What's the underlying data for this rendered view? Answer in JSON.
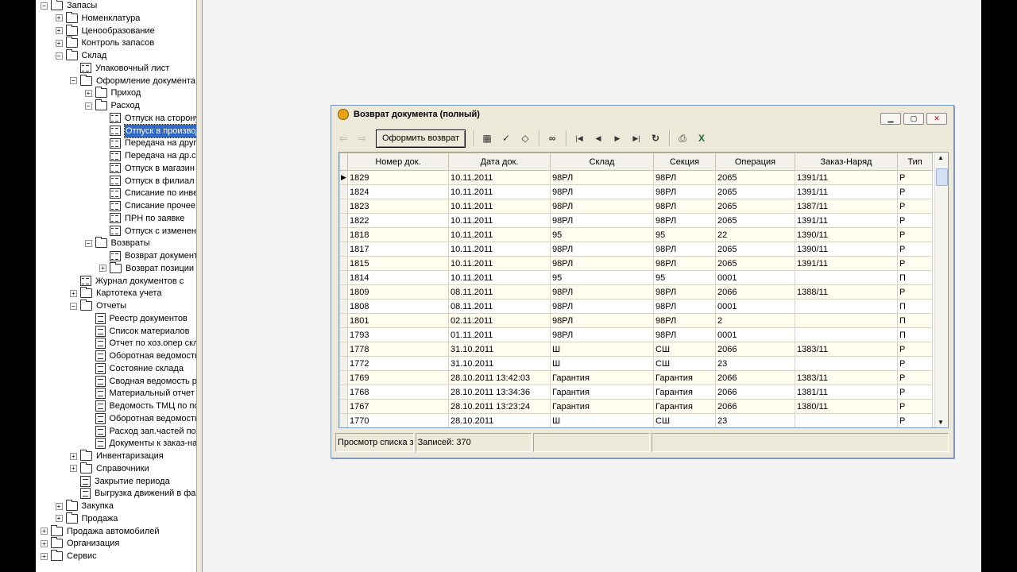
{
  "tree": {
    "items": [
      {
        "label": "Запасы",
        "icon": "folder",
        "toggle": "-"
      },
      {
        "label": "Номенклатура",
        "icon": "folder",
        "toggle": "+"
      },
      {
        "label": "Ценообразование",
        "icon": "folder",
        "toggle": "+"
      },
      {
        "label": "Контроль запасов",
        "icon": "folder",
        "toggle": "+"
      },
      {
        "label": "Склад",
        "icon": "folder",
        "toggle": "-"
      },
      {
        "label": "Упаковочный лист",
        "icon": "list",
        "toggle": ""
      },
      {
        "label": "Оформление документа",
        "icon": "folder",
        "toggle": "-"
      },
      {
        "label": "Приход",
        "icon": "folder",
        "toggle": "+"
      },
      {
        "label": "Расход",
        "icon": "folder",
        "toggle": "-"
      },
      {
        "label": "Отпуск на сторону",
        "icon": "list",
        "toggle": ""
      },
      {
        "label": "Отпуск в производ",
        "icon": "list",
        "toggle": ""
      },
      {
        "label": "Передача на другой",
        "icon": "list",
        "toggle": ""
      },
      {
        "label": "Передача на др.скл",
        "icon": "list",
        "toggle": ""
      },
      {
        "label": "Отпуск в магазин",
        "icon": "list",
        "toggle": ""
      },
      {
        "label": "Отпуск в филиал",
        "icon": "list",
        "toggle": ""
      },
      {
        "label": "Списание по инвент",
        "icon": "list",
        "toggle": ""
      },
      {
        "label": "Списание прочее",
        "icon": "list",
        "toggle": ""
      },
      {
        "label": "ПРН по заявке",
        "icon": "list",
        "toggle": ""
      },
      {
        "label": "Отпуск с изменен",
        "icon": "list",
        "toggle": ""
      },
      {
        "label": "Возвраты",
        "icon": "folder",
        "toggle": "-"
      },
      {
        "label": "Возврат документ",
        "icon": "list",
        "toggle": ""
      },
      {
        "label": "Возврат позиции д",
        "icon": "folder",
        "toggle": "+"
      },
      {
        "label": "Журнал документов с",
        "icon": "list",
        "toggle": ""
      },
      {
        "label": "Картотека учета",
        "icon": "folder",
        "toggle": "+"
      },
      {
        "label": "Отчеты",
        "icon": "folder",
        "toggle": "-"
      },
      {
        "label": "Реестр документов",
        "icon": "doc",
        "toggle": ""
      },
      {
        "label": "Список материалов",
        "icon": "doc",
        "toggle": ""
      },
      {
        "label": "Отчет по хоз.опер скл",
        "icon": "doc",
        "toggle": ""
      },
      {
        "label": "Оборотная ведомость",
        "icon": "doc",
        "toggle": ""
      },
      {
        "label": "Состояние склада",
        "icon": "doc",
        "toggle": ""
      },
      {
        "label": "Сводная ведомость ра",
        "icon": "doc",
        "toggle": ""
      },
      {
        "label": "Материальный отчет",
        "icon": "doc",
        "toggle": ""
      },
      {
        "label": "Ведомость ТМЦ по по",
        "icon": "doc",
        "toggle": ""
      },
      {
        "label": "Оборотная ведомость",
        "icon": "doc",
        "toggle": ""
      },
      {
        "label": "Расход зап.частей по",
        "icon": "doc",
        "toggle": ""
      },
      {
        "label": "Документы к заказ-на",
        "icon": "doc",
        "toggle": ""
      },
      {
        "label": "Инвентаризация",
        "icon": "folder",
        "toggle": "+"
      },
      {
        "label": "Справочники",
        "icon": "folder",
        "toggle": "+"
      },
      {
        "label": "Закрытие периода",
        "icon": "doc",
        "toggle": ""
      },
      {
        "label": "Выгрузка движений в фай",
        "icon": "doc",
        "toggle": ""
      },
      {
        "label": "Закупка",
        "icon": "folder",
        "toggle": "+"
      },
      {
        "label": "Продажа",
        "icon": "folder",
        "toggle": "+"
      },
      {
        "label": "Продажа автомобилей",
        "icon": "folder",
        "toggle": "+"
      },
      {
        "label": "Организация",
        "icon": "folder",
        "toggle": "+"
      },
      {
        "label": "Сервис",
        "icon": "folder",
        "toggle": "+"
      }
    ]
  },
  "dialog": {
    "title": "Возврат документа (полный)",
    "toolbar": {
      "process_return_label": "Оформить возврат"
    },
    "columns": [
      "Номер док.",
      "Дата док.",
      "Склад",
      "Секция",
      "Операция",
      "Заказ-Наряд",
      "Тип"
    ],
    "rows": [
      [
        "1829",
        "10.11.2011",
        "98РЛ",
        "98РЛ",
        "2065",
        "1391/11",
        "Р"
      ],
      [
        "1824",
        "10.11.2011",
        "98РЛ",
        "98РЛ",
        "2065",
        "1391/11",
        "Р"
      ],
      [
        "1823",
        "10.11.2011",
        "98РЛ",
        "98РЛ",
        "2065",
        "1387/11",
        "Р"
      ],
      [
        "1822",
        "10.11.2011",
        "98РЛ",
        "98РЛ",
        "2065",
        "1391/11",
        "Р"
      ],
      [
        "1818",
        "10.11.2011",
        "95",
        "95",
        "22",
        "1390/11",
        "Р"
      ],
      [
        "1817",
        "10.11.2011",
        "98РЛ",
        "98РЛ",
        "2065",
        "1390/11",
        "Р"
      ],
      [
        "1815",
        "10.11.2011",
        "98РЛ",
        "98РЛ",
        "2065",
        "1391/11",
        "Р"
      ],
      [
        "1814",
        "10.11.2011",
        "95",
        "95",
        "0001",
        "",
        "П"
      ],
      [
        "1809",
        "08.11.2011",
        "98РЛ",
        "98РЛ",
        "2066",
        "1388/11",
        "Р"
      ],
      [
        "1808",
        "08.11.2011",
        "98РЛ",
        "98РЛ",
        "0001",
        "",
        "П"
      ],
      [
        "1801",
        "02.11.2011",
        "98РЛ",
        "98РЛ",
        "2",
        "",
        "П"
      ],
      [
        "1793",
        "01.11.2011",
        "98РЛ",
        "98РЛ",
        "0001",
        "",
        "П"
      ],
      [
        "1778",
        "31.10.2011",
        "Ш",
        "СШ",
        "2066",
        "1383/11",
        "Р"
      ],
      [
        "1772",
        "31.10.2011",
        "Ш",
        "СШ",
        "23",
        "",
        "Р"
      ],
      [
        "1769",
        "28.10.2011 13:42:03",
        "Гарантия",
        "Гарантия",
        "2066",
        "1383/11",
        "Р"
      ],
      [
        "1768",
        "28.10.2011 13:34:36",
        "Гарантия",
        "Гарантия",
        "2066",
        "1381/11",
        "Р"
      ],
      [
        "1767",
        "28.10.2011 13:23:24",
        "Гарантия",
        "Гарантия",
        "2066",
        "1380/11",
        "Р"
      ],
      [
        "1770",
        "28.10.2011",
        "Ш",
        "СШ",
        "23",
        "",
        "Р"
      ]
    ],
    "status": {
      "mode": "Просмотр списка за",
      "records": "Записей: 370"
    }
  },
  "colors": {
    "selection": "#316ac5",
    "row_highlight": "#fffdf0",
    "window_face": "#ece9d8"
  }
}
